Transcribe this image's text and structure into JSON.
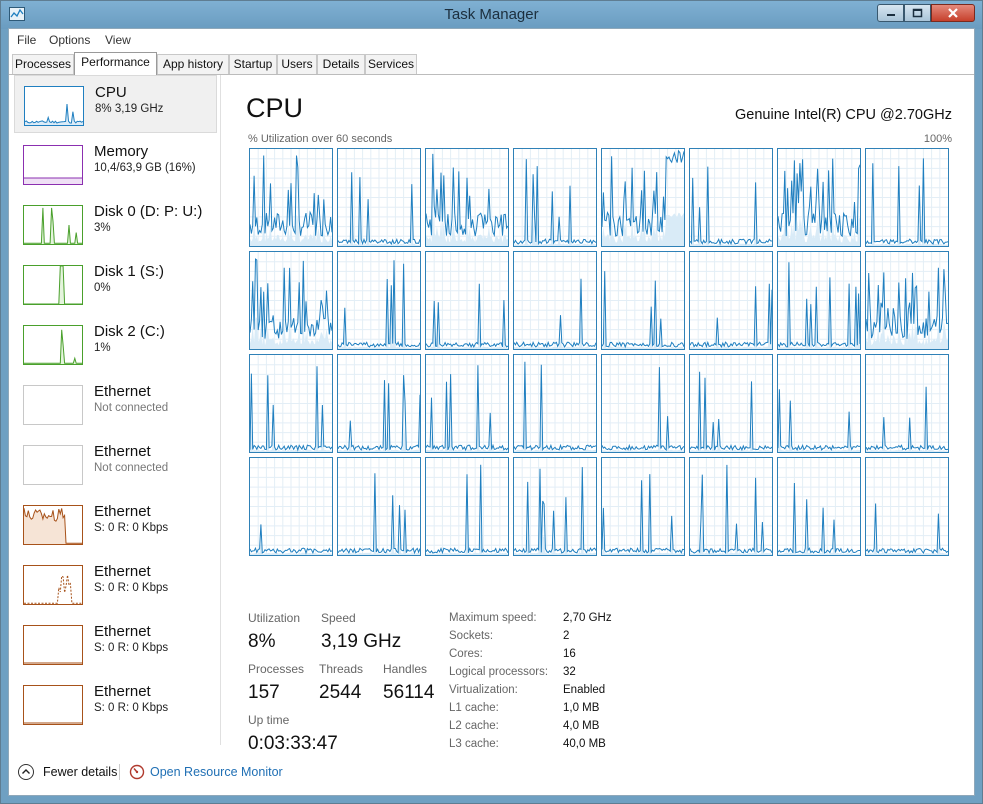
{
  "window": {
    "title": "Task Manager"
  },
  "menu": [
    "File",
    "Options",
    "View"
  ],
  "tabs": [
    "Processes",
    "Performance",
    "App history",
    "Startup",
    "Users",
    "Details",
    "Services"
  ],
  "active_tab": "Performance",
  "sidebar": [
    {
      "name": "CPU",
      "sub": "8% 3,19 GHz",
      "color": "#1f7fc0",
      "kind": "cpu",
      "selected": true
    },
    {
      "name": "Memory",
      "sub": "10,4/63,9 GB (16%)",
      "color": "#8b2fb0",
      "kind": "memory"
    },
    {
      "name": "Disk 0 (D: P: U:)",
      "sub": "3%",
      "color": "#4aa02c",
      "kind": "disk0"
    },
    {
      "name": "Disk 1 (S:)",
      "sub": "0%",
      "color": "#4aa02c",
      "kind": "disk1"
    },
    {
      "name": "Disk 2 (C:)",
      "sub": "1%",
      "color": "#4aa02c",
      "kind": "disk2"
    },
    {
      "name": "Ethernet",
      "sub": "Not connected",
      "color": "#c8c8c8",
      "kind": "none",
      "muted": true
    },
    {
      "name": "Ethernet",
      "sub": "Not connected",
      "color": "#c8c8c8",
      "kind": "none",
      "muted": true
    },
    {
      "name": "Ethernet",
      "sub": "S: 0 R: 0 Kbps",
      "color": "#a7521a",
      "kind": "eth1"
    },
    {
      "name": "Ethernet",
      "sub": "S: 0 R: 0 Kbps",
      "color": "#a7521a",
      "kind": "eth2"
    },
    {
      "name": "Ethernet",
      "sub": "S: 0 R: 0 Kbps",
      "color": "#a7521a",
      "kind": "flat"
    },
    {
      "name": "Ethernet",
      "sub": "S: 0 R: 0 Kbps",
      "color": "#a7521a",
      "kind": "flat"
    }
  ],
  "main": {
    "title": "CPU",
    "model": "Genuine Intel(R) CPU @2.70GHz",
    "util_label": "% Utilization over 60 seconds",
    "util_max": "100%",
    "logical_processors_shown": 32
  },
  "stats": {
    "utilization_label": "Utilization",
    "utilization": "8%",
    "speed_label": "Speed",
    "speed": "3,19 GHz",
    "processes_label": "Processes",
    "processes": "157",
    "threads_label": "Threads",
    "threads": "2544",
    "handles_label": "Handles",
    "handles": "56114",
    "uptime_label": "Up time",
    "uptime": "0:03:33:47"
  },
  "specs": [
    {
      "k": "Maximum speed:",
      "v": "2,70 GHz"
    },
    {
      "k": "Sockets:",
      "v": "2"
    },
    {
      "k": "Cores:",
      "v": "16"
    },
    {
      "k": "Logical processors:",
      "v": "32"
    },
    {
      "k": "Virtualization:",
      "v": "Enabled"
    },
    {
      "k": "L1 cache:",
      "v": "1,0 MB"
    },
    {
      "k": "L2 cache:",
      "v": "4,0 MB"
    },
    {
      "k": "L3 cache:",
      "v": "40,0 MB"
    }
  ],
  "footer": {
    "fewer": "Fewer details",
    "resmon": "Open Resource Monitor"
  },
  "colors": {
    "cpu_line": "#1f7fc0",
    "cpu_fill": "#d9ebf7",
    "grid": "#e3eef6"
  }
}
